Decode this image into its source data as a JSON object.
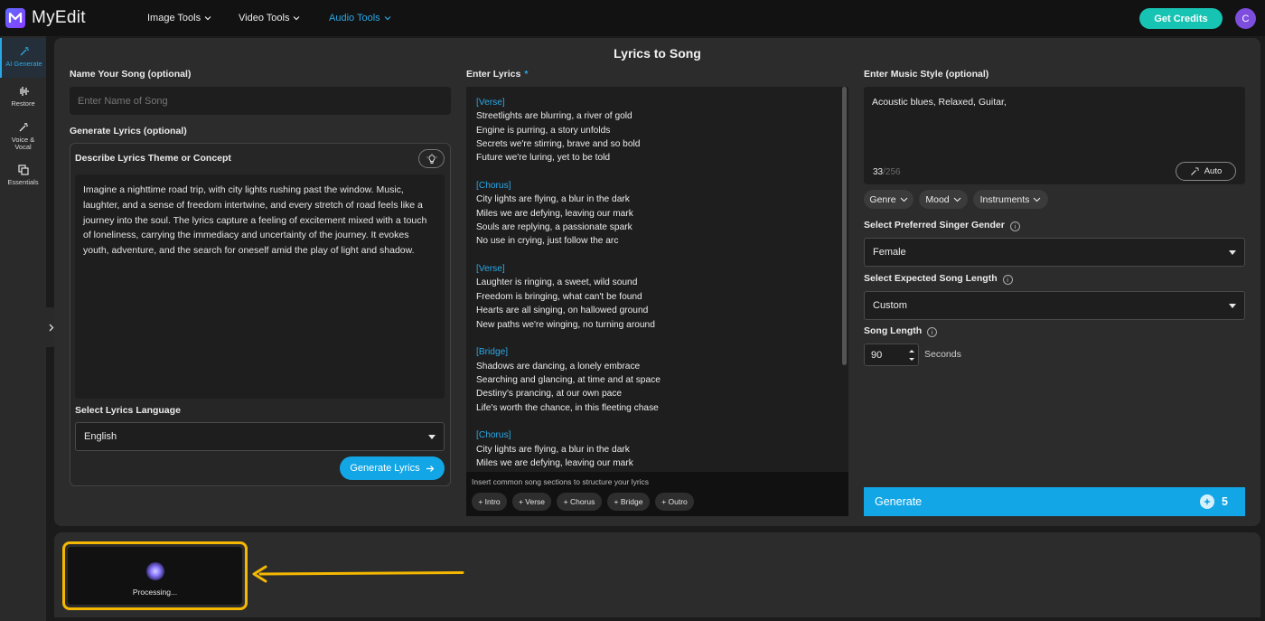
{
  "app": {
    "brand": "MyEdit",
    "nav": [
      {
        "label": "Image Tools"
      },
      {
        "label": "Video Tools"
      },
      {
        "label": "Audio Tools"
      }
    ],
    "get_credits": "Get Credits",
    "avatar_initial": "C"
  },
  "sidebar": {
    "items": [
      {
        "label": "AI Generate",
        "active": true
      },
      {
        "label": "Restore"
      },
      {
        "label": "Voice & Vocal"
      },
      {
        "label": "Essentials"
      }
    ]
  },
  "page": {
    "title": "Lyrics to Song"
  },
  "left": {
    "name_label": "Name Your Song (optional)",
    "name_placeholder": "Enter Name of Song",
    "gen_lyrics_label": "Generate Lyrics (optional)",
    "theme_label": "Describe Lyrics Theme or Concept",
    "theme_text": "Imagine a nighttime road trip, with city lights rushing past the window. Music, laughter, and a sense of freedom intertwine, and every stretch of road feels like a journey into the soul. The lyrics capture a feeling of excitement mixed with a touch of loneliness, carrying the immediacy and uncertainty of the journey. It evokes youth, adventure, and the search for oneself amid the play of light and shadow.",
    "language_label": "Select Lyrics Language",
    "language_value": "English",
    "generate_lyrics_button": "Generate Lyrics"
  },
  "lyrics": {
    "label": "Enter Lyrics",
    "required_mark": "*",
    "blocks": [
      {
        "section": "[Verse]",
        "lines": [
          "Streetlights are blurring, a river of gold",
          "Engine is purring, a story unfolds",
          "Secrets we're stirring, brave and so bold",
          "Future we're luring, yet to be told"
        ]
      },
      {
        "section": "[Chorus]",
        "lines": [
          "City lights are flying, a blur in the dark",
          "Miles we are defying, leaving our mark",
          "Souls are replying, a passionate spark",
          "No use in crying, just follow the arc"
        ]
      },
      {
        "section": "[Verse]",
        "lines": [
          "Laughter is ringing, a sweet, wild sound",
          "Freedom is bringing, what can't be found",
          "Hearts are all singing, on hallowed ground",
          "New paths we're winging, no turning around"
        ]
      },
      {
        "section": "[Bridge]",
        "lines": [
          "Shadows are dancing, a lonely embrace",
          "Searching and glancing, at time and at space",
          "Destiny's prancing, at our own pace",
          "Life's worth the chance, in this fleeting chase"
        ]
      },
      {
        "section": "[Chorus]",
        "lines": [
          "City lights are flying, a blur in the dark",
          "Miles we are defying, leaving our mark"
        ]
      }
    ],
    "footer_hint": "Insert common song sections to structure your lyrics",
    "chips": [
      "+ Intro",
      "+ Verse",
      "+ Chorus",
      "+ Bridge",
      "+ Outro"
    ]
  },
  "right": {
    "style_label": "Enter Music Style (optional)",
    "style_value": "Acoustic blues, Relaxed, Guitar,",
    "char_count": "33",
    "char_max": "/256",
    "auto_button": "Auto",
    "pills": [
      "Genre",
      "Mood",
      "Instruments"
    ],
    "gender_label": "Select Preferred Singer Gender",
    "gender_value": "Female",
    "length_label": "Select Expected Song Length",
    "length_value": "Custom",
    "song_length_label": "Song Length",
    "song_length_value": "90",
    "song_length_unit": "Seconds",
    "generate_button": "Generate",
    "generate_cost": "5"
  },
  "queue": {
    "status": "Processing..."
  },
  "colors": {
    "accent": "#12a6e6",
    "credits": "#17c3b2",
    "highlight": "#f5b800"
  }
}
